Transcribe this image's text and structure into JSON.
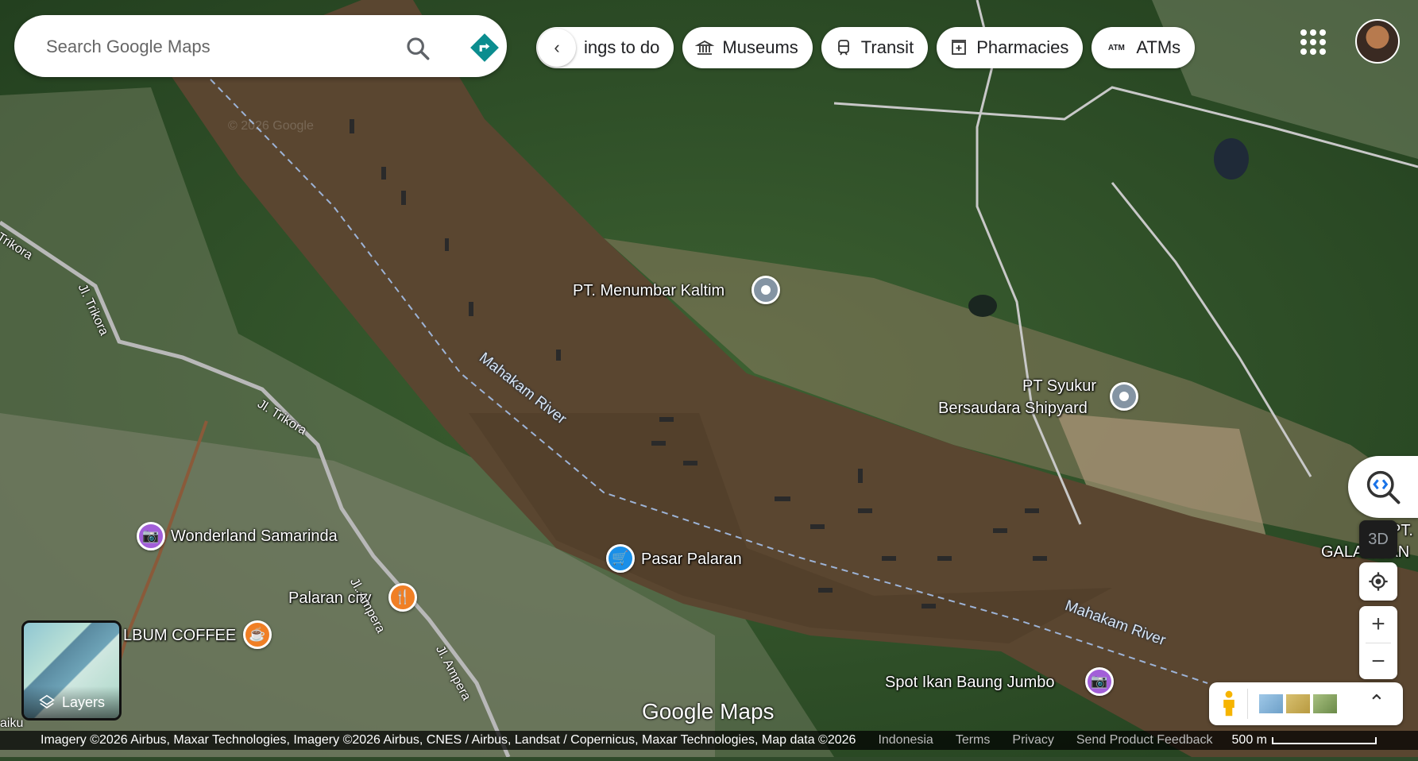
{
  "search": {
    "placeholder": "Search Google Maps"
  },
  "chips": [
    {
      "label": "ings to do",
      "icon": "chevron-left-icon"
    },
    {
      "label": "Museums",
      "icon": "museum-icon"
    },
    {
      "label": "Transit",
      "icon": "train-icon"
    },
    {
      "label": "Pharmacies",
      "icon": "pharmacy-icon"
    },
    {
      "label": "ATMs",
      "icon": "atm-icon",
      "icon_text": "ATM"
    }
  ],
  "places": {
    "menumbar": "PT. Menumbar Kaltim",
    "syukur_1": "PT Syukur",
    "syukur_2": "Bersaudara Shipyard",
    "wonderland": "Wonderland Samarinda",
    "palaran_city": "Palaran city",
    "pasar": "Pasar Palaran",
    "album_coffee": "LBUM COFFEE",
    "spot_ikan": "Spot Ikan Baung Jumbo",
    "galangan_1": "PT.",
    "galangan_2": "GALANGAN"
  },
  "roads": {
    "trikora_1": "Trikora",
    "trikora_2": "Jl. Trikora",
    "trikora_3": "Jl. Trikora",
    "ampera": "Jl. Ampera",
    "ampera_2": "Jl. Ampera",
    "kaiku": "aiku"
  },
  "rivers": {
    "r1": "Mahakam River",
    "r2": "Mahakam River"
  },
  "watermark": "© 2026 Google",
  "controls": {
    "btn_3d": "3D",
    "zoom_in": "+",
    "zoom_out": "−",
    "layers": "Layers",
    "expand": "⌃"
  },
  "brand": "Google Maps",
  "attribution": {
    "text": "Imagery ©2026 Airbus, Maxar Technologies, Imagery ©2026 Airbus, CNES / Airbus, Landsat / Copernicus, Maxar Technologies, Map data ©2026",
    "country": "Indonesia",
    "terms": "Terms",
    "privacy": "Privacy",
    "feedback": "Send Product Feedback",
    "scale": "500 m"
  },
  "colors": {
    "river": "#5a4630",
    "vegetation": "#2e4f27",
    "brand_blue": "#1a73e8"
  }
}
